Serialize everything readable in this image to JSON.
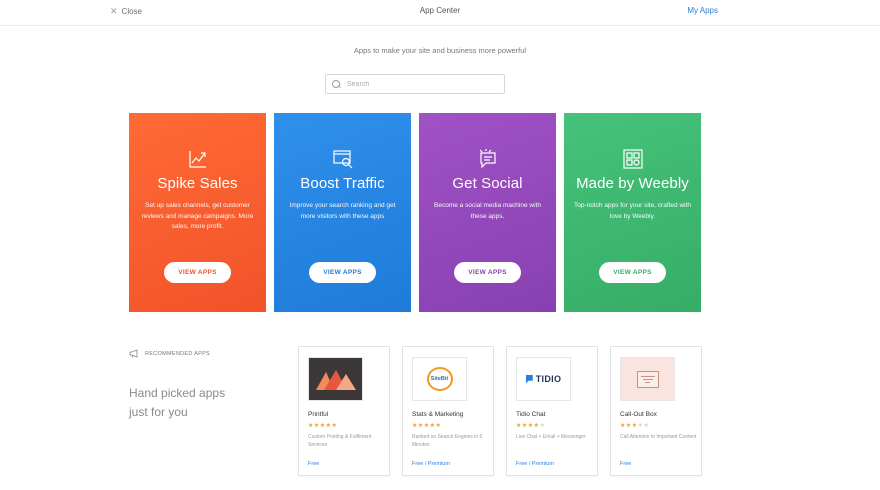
{
  "header": {
    "close_label": "Close",
    "title": "App Center",
    "my_apps_label": "My Apps"
  },
  "tagline": "Apps to make your site and business more powerful",
  "search": {
    "placeholder": "Search",
    "value": ""
  },
  "categories": [
    {
      "title": "Spike Sales",
      "description": "Set up sales channels, get customer reviews and manage campaigns. More sales, more profit.",
      "button": "VIEW APPS",
      "icon": "chart-growth-icon",
      "color": "#f1532a"
    },
    {
      "title": "Boost Traffic",
      "description": "Improve your search ranking and get more visitors with these apps",
      "button": "VIEW APPS",
      "icon": "search-window-icon",
      "color": "#1f7bd8"
    },
    {
      "title": "Get Social",
      "description": "Become a social media machine with these apps.",
      "button": "VIEW APPS",
      "icon": "chat-bubble-icon",
      "color": "#8840b1"
    },
    {
      "title": "Made by Weebly",
      "description": "Top-notch apps for your site, crafted with love by Weebly.",
      "button": "VIEW APPS",
      "icon": "grid-apps-icon",
      "color": "#36ad66"
    }
  ],
  "recommended": {
    "heading": "RECOMMENDED APPS",
    "subheading_line1": "Hand picked apps",
    "subheading_line2": "just for you",
    "apps": [
      {
        "name": "Printful",
        "stars": 5,
        "description": "Custom Printing & Fulfilment Services",
        "price": "Free"
      },
      {
        "name": "Stats & Marketing",
        "stars": 5,
        "description": "Ranked on Search Engines in 5 Minutes",
        "price": "Free / Premium",
        "logo_text": "SiteBit"
      },
      {
        "name": "Tidio Chat",
        "stars": 4,
        "description": "Live Chat + Email + Messenger",
        "price": "Free / Premium",
        "logo_text": "TIDIO"
      },
      {
        "name": "Call-Out Box",
        "stars": 3,
        "description": "Call Attention to Important Content",
        "price": "Free"
      }
    ]
  }
}
